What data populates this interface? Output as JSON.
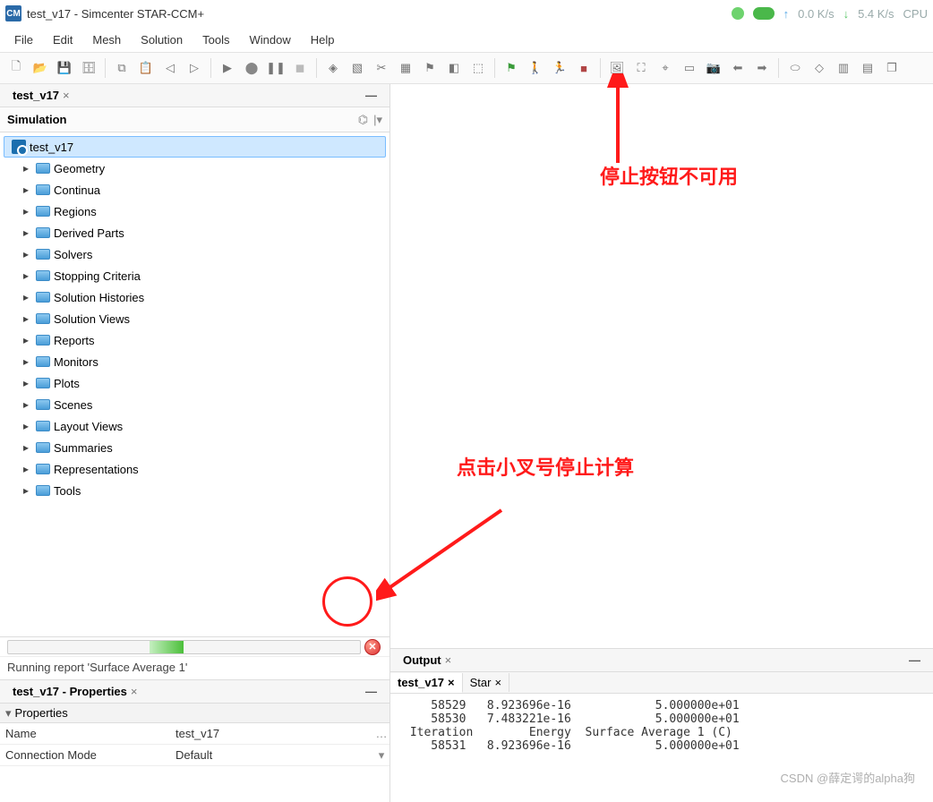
{
  "title": "test_v17 - Simcenter STAR-CCM+",
  "app_icon_text": "CM",
  "network": {
    "up": "0.0 K/s",
    "down": "5.4 K/s",
    "cpu": "CPU"
  },
  "menu": [
    "File",
    "Edit",
    "Mesh",
    "Solution",
    "Tools",
    "Window",
    "Help"
  ],
  "toolbar_icons": [
    "new-file-icon",
    "open-file-icon",
    "save-icon",
    "save-all-icon",
    "sep",
    "copy-icon",
    "paste-icon",
    "back-icon",
    "forward-icon",
    "sep",
    "play-icon",
    "record-icon",
    "pause-icon",
    "stop-dim-icon",
    "sep",
    "mesh-icon",
    "select-icon",
    "crop-icon",
    "grid-icon",
    "flag-icon",
    "plane-icon",
    "cube-icon",
    "sep",
    "flag-green-icon",
    "walk-icon",
    "run-person-icon",
    "stop-red-icon",
    "sep",
    "image-icon",
    "fit-icon",
    "target-icon",
    "select-rect-icon",
    "camera-icon",
    "left-icon",
    "right-icon",
    "sep",
    "cylinder-icon",
    "diamond-icon",
    "multigrid-icon",
    "grid2-icon",
    "copy2-icon"
  ],
  "sim_tab_label": "test_v17",
  "sim_header": "Simulation",
  "tree_root": "test_v17",
  "tree_children": [
    "Geometry",
    "Continua",
    "Regions",
    "Derived Parts",
    "Solvers",
    "Stopping Criteria",
    "Solution Histories",
    "Solution Views",
    "Reports",
    "Monitors",
    "Plots",
    "Scenes",
    "Layout Views",
    "Summaries",
    "Representations",
    "Tools"
  ],
  "status_text": "Running report 'Surface Average 1'",
  "props_tab": "test_v17 - Properties",
  "props_header": "Properties",
  "props": {
    "name_k": "Name",
    "name_v": "test_v17",
    "conn_k": "Connection Mode",
    "conn_v": "Default"
  },
  "output_tab": "Output",
  "output_subtab1": "test_v17",
  "output_subtab2": "Star",
  "output_lines": [
    "    58529   8.923696e-16            5.000000e+01",
    "    58530   7.483221e-16            5.000000e+01",
    " Iteration        Energy  Surface Average 1 (C)",
    "    58531   8.923696e-16            5.000000e+01"
  ],
  "annot1": "停止按钮不可用",
  "annot2": "点击小叉号停止计算",
  "watermark": "CSDN @薛定谔的alpha狗"
}
